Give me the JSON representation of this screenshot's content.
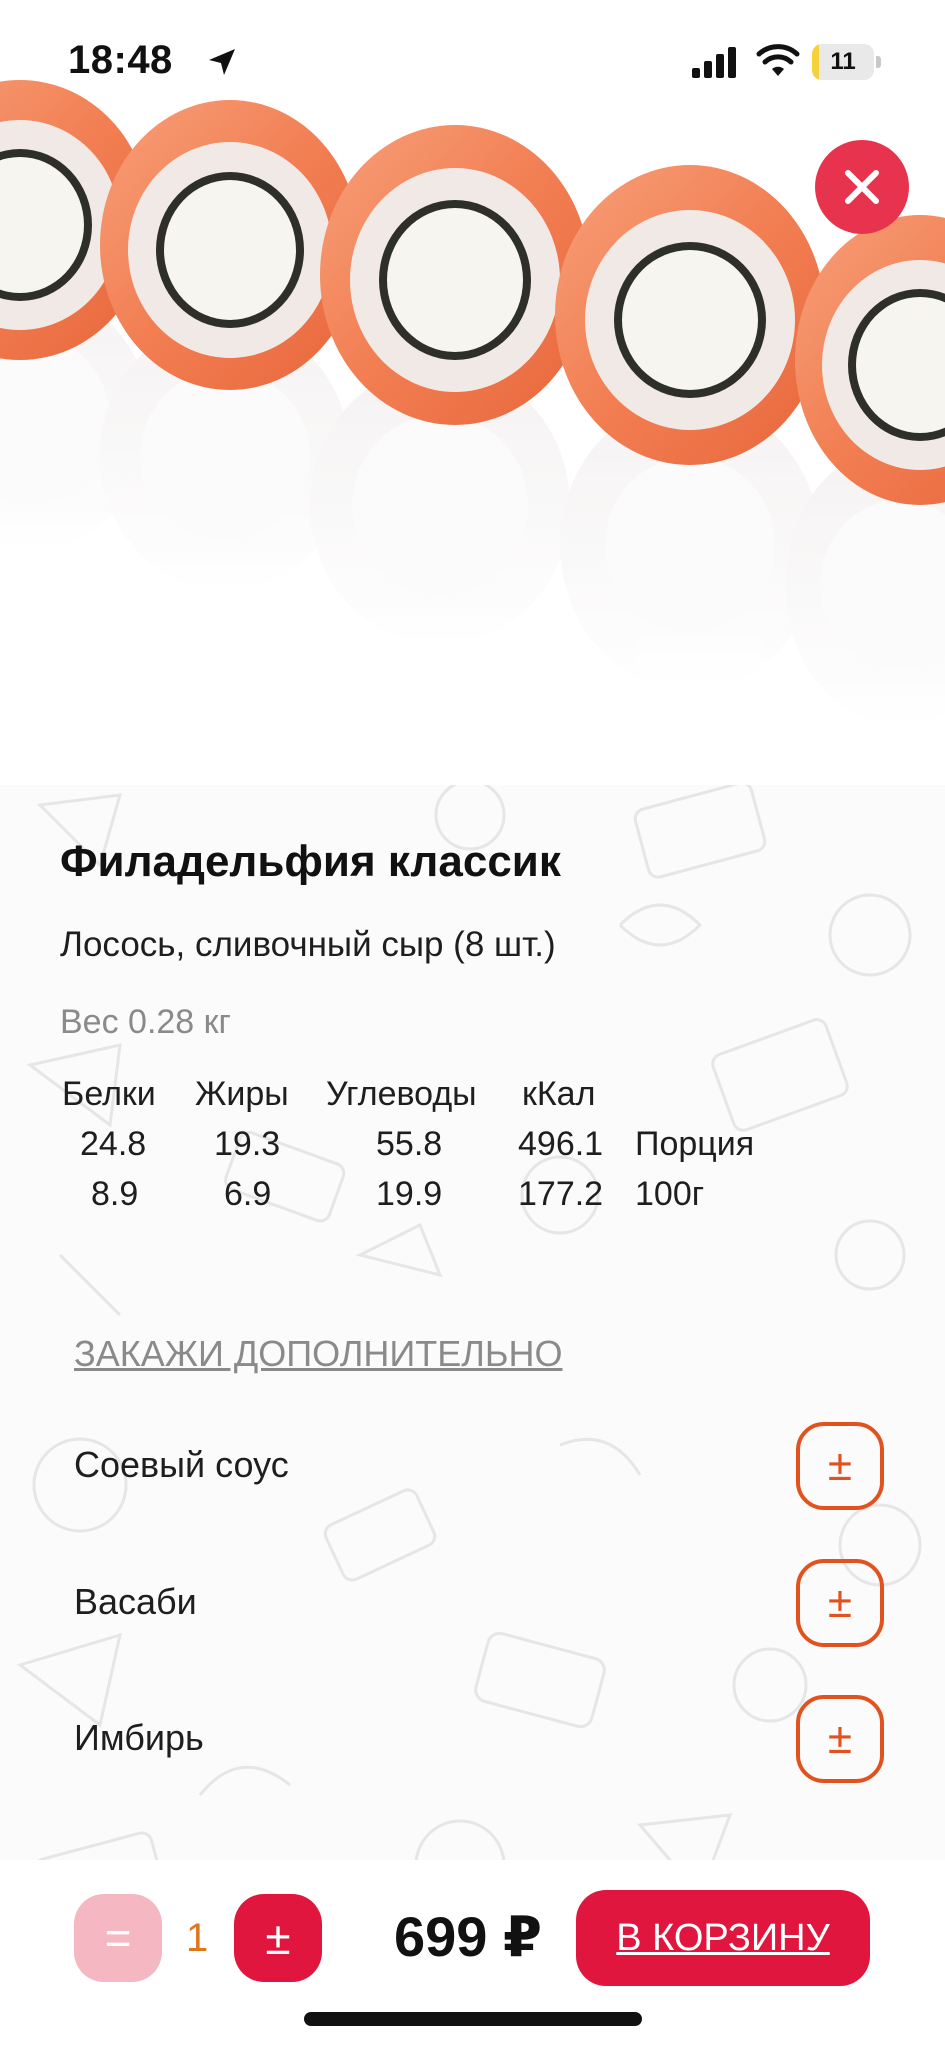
{
  "status_bar": {
    "time": "18:48",
    "battery_level": "11",
    "battery_fraction": 0.11,
    "icons": [
      "location-arrow-icon",
      "cellular-signal-icon",
      "wifi-icon",
      "battery-icon"
    ]
  },
  "hero": {
    "close_icon": "close-icon",
    "accent_color": "#e8334f"
  },
  "product": {
    "title": "Филадельфия классик",
    "description": "Лосось, сливочный сыр (8 шт.)",
    "weight": "Вес 0.28 кг"
  },
  "nutrition": {
    "headers": [
      "Белки",
      "Жиры",
      "Углеводы",
      "кКал"
    ],
    "rows": [
      {
        "values": [
          "24.8",
          "19.3",
          "55.8",
          "496.1"
        ],
        "label": "Порция"
      },
      {
        "values": [
          "8.9",
          "6.9",
          "19.9",
          "177.2"
        ],
        "label": "100г"
      }
    ]
  },
  "extras": {
    "heading": "ЗАКАЖИ ДОПОЛНИТЕЛЬНО",
    "items": [
      {
        "label": "Соевый соус",
        "button": "±"
      },
      {
        "label": "Васаби",
        "button": "±"
      },
      {
        "label": "Имбирь",
        "button": "±"
      }
    ],
    "button_color": "#e2521f"
  },
  "cart": {
    "minus_label": "=",
    "quantity": "1",
    "plus_label": "±",
    "price": "699 ₽",
    "add_to_cart_label": "В КОРЗИНУ",
    "button_color": "#e1163e"
  }
}
